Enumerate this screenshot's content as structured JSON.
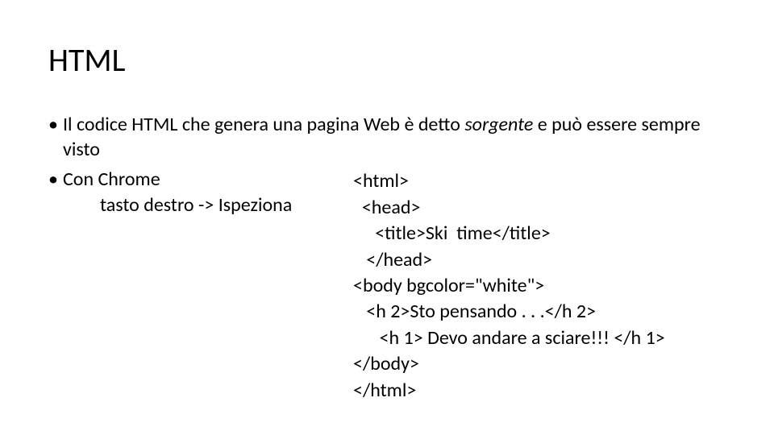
{
  "title": "HTML",
  "bullet1": {
    "prefix": "Il codice HTML che genera una pagina Web è detto ",
    "em": "sorgente",
    "suffix": " e  può essere sempre visto"
  },
  "bullet2": {
    "line1": "Con Chrome",
    "line2": "tasto destro -> Ispeziona"
  },
  "code": {
    "l1": "<html>",
    "l2": "  <head>",
    "l3": "     <title>Ski  time</title>",
    "l4": "   </head>",
    "l5": "<body bgcolor=\"white\">",
    "l6": "   <h 2>Sto pensando . . .</h 2>",
    "l7": "      <h 1> Devo andare a sciare!!! </h 1>",
    "l8": "</body>",
    "l9": "</html>"
  }
}
